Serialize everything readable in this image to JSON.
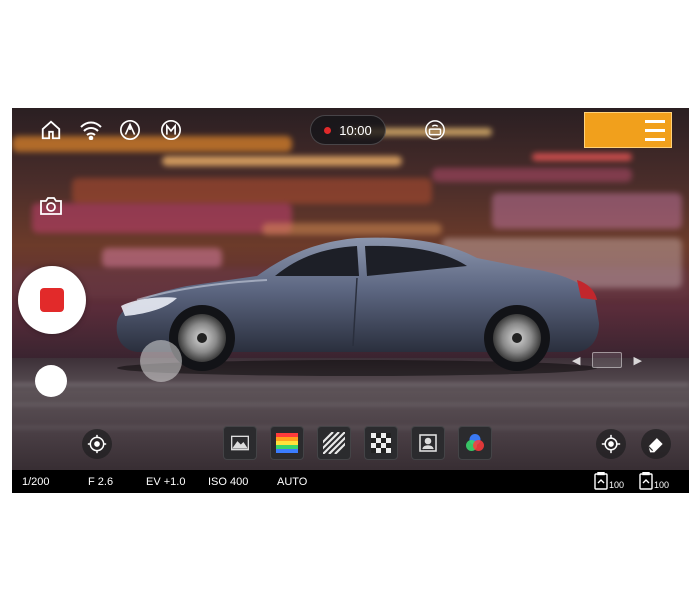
{
  "top_bar": {
    "timer": "10:00",
    "icons": [
      "home-icon",
      "wifi-icon",
      "compass-icon",
      "manual-mode-icon",
      "router-icon"
    ]
  },
  "status_bar": {
    "shutter": "1/200",
    "aperture": "F 2.6",
    "exposure": "EV +1.0",
    "iso": "ISO 400",
    "white_balance": "AUTO",
    "battery_1": "100",
    "battery_2": "100"
  },
  "toolbar": {
    "tools": [
      "image-profile-icon",
      "color-bars-icon",
      "zebra-icon",
      "focus-peaking-icon",
      "portrait-frame-icon",
      "rgb-circles-icon"
    ]
  },
  "colors": {
    "record": "#e22a2a",
    "accent_orange": "#f1a01c"
  }
}
